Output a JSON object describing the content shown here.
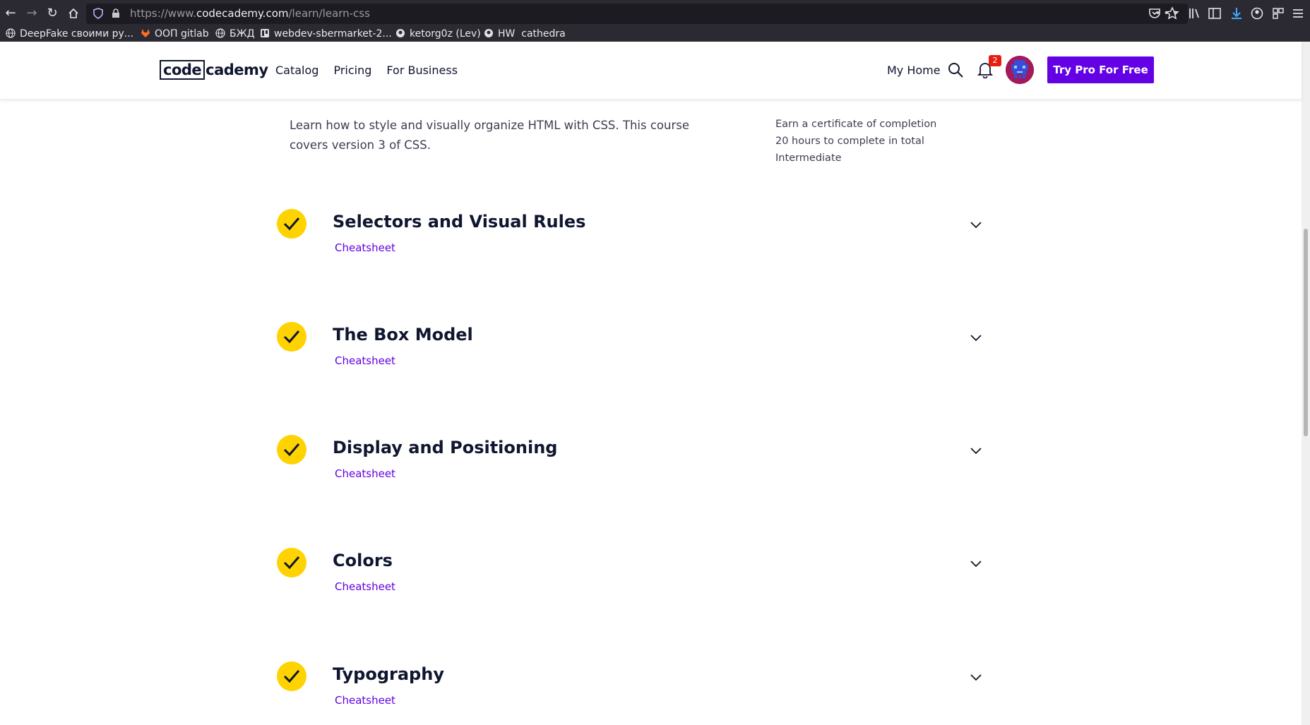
{
  "browser": {
    "url_prefix": "https://www.",
    "url_host": "codecademy.com",
    "url_path": "/learn/learn-css",
    "url_more": "•••",
    "bookmarks": [
      {
        "label": "DeepFake своими ру...",
        "icon": "globe-icon"
      },
      {
        "label": "ООП gitlab",
        "icon": "gitlab-icon"
      },
      {
        "label": "БЖД",
        "icon": "globe-icon"
      },
      {
        "label": "webdev-sbermarket-2...",
        "icon": "trello-icon"
      },
      {
        "label": "ketorg0z (Lev)",
        "icon": "github-icon"
      },
      {
        "label": "HW  cathedra",
        "icon": "github-icon"
      }
    ]
  },
  "header": {
    "logo_boxed": "code",
    "logo_rest": "cademy",
    "nav": [
      "Catalog",
      "Pricing",
      "For Business"
    ],
    "my_home": "My Home",
    "notification_count": "2",
    "cta": "Try Pro For Free"
  },
  "course": {
    "description": "Learn how to style and visually organize HTML with CSS. This course covers version 3 of CSS.",
    "facts": [
      "Earn a certificate of completion",
      "20 hours to complete in total",
      "Intermediate"
    ]
  },
  "modules": [
    {
      "title": "Selectors and Visual Rules",
      "link": "Cheatsheet",
      "completed": true
    },
    {
      "title": "The Box Model",
      "link": "Cheatsheet",
      "completed": true
    },
    {
      "title": "Display and Positioning",
      "link": "Cheatsheet",
      "completed": true
    },
    {
      "title": "Colors",
      "link": "Cheatsheet",
      "completed": true
    },
    {
      "title": "Typography",
      "link": "Cheatsheet",
      "completed": true
    }
  ],
  "colors": {
    "brand": "#6400e4",
    "check": "#ffd300",
    "navy": "#10162f",
    "badge": "#e91c11"
  }
}
